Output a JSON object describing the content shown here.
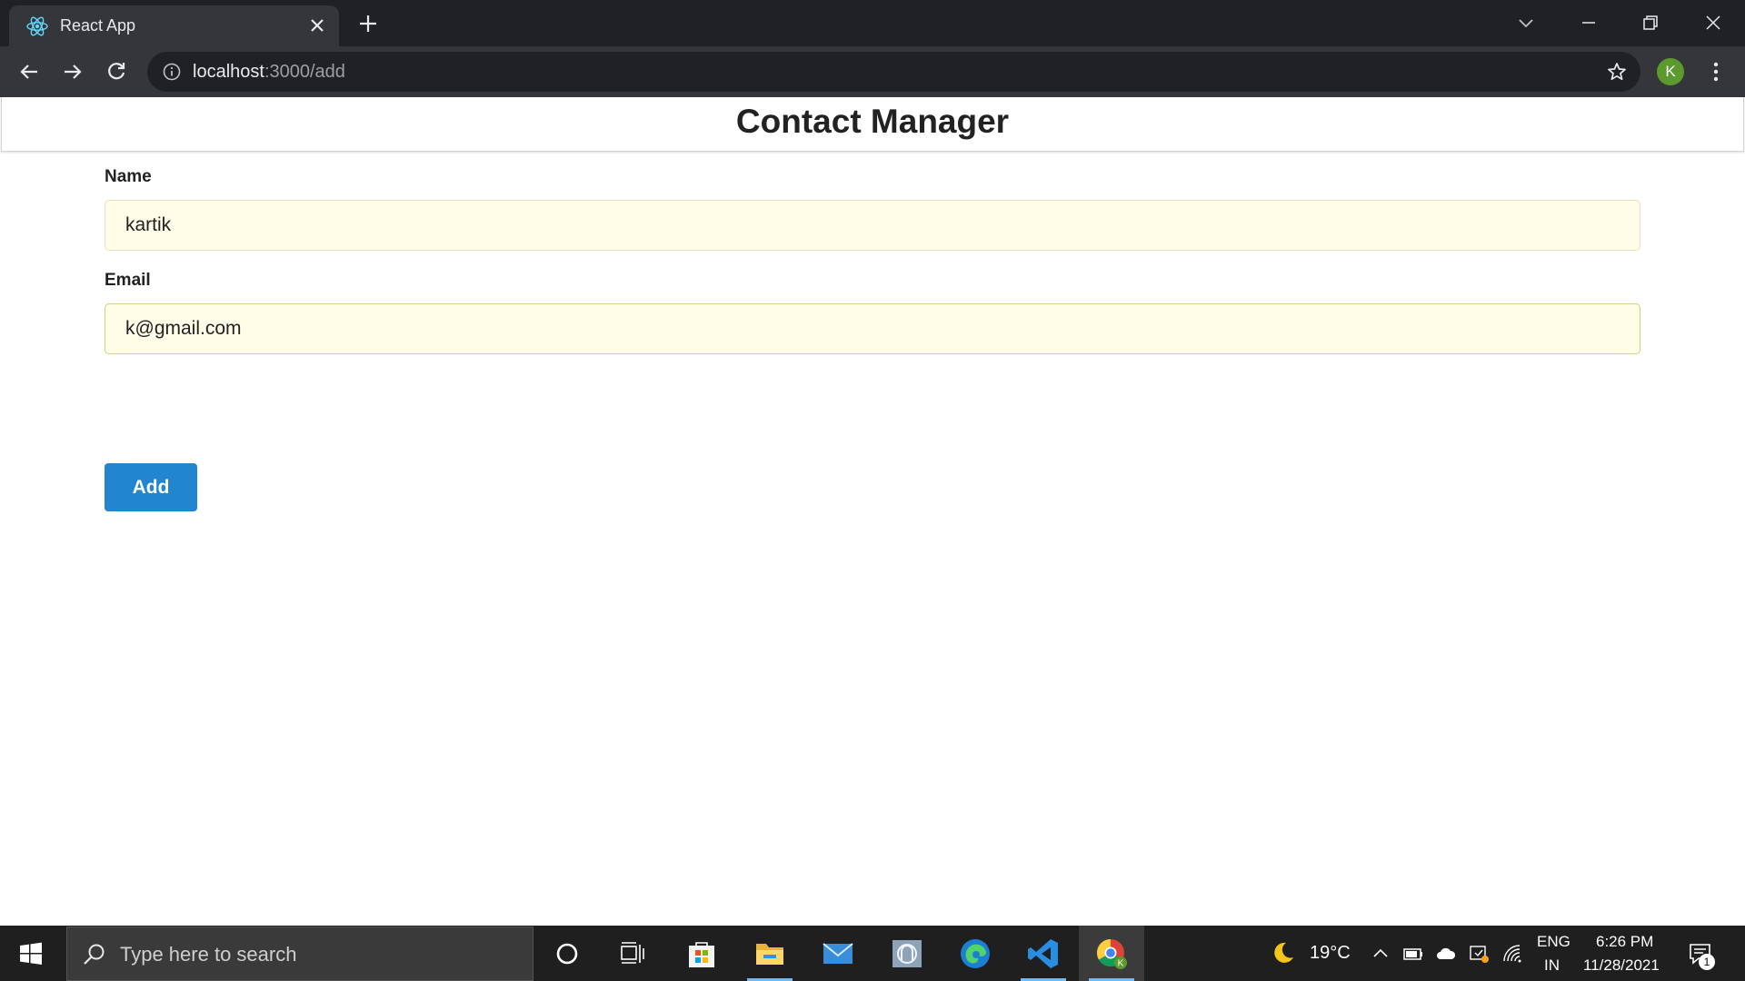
{
  "browser": {
    "tab_title": "React App",
    "url_host": "localhost",
    "url_path": ":3000/add",
    "profile_initial": "K"
  },
  "page": {
    "title": "Contact Manager",
    "form": {
      "name_label": "Name",
      "name_value": "kartik",
      "email_label": "Email",
      "email_value": "k@gmail.com",
      "add_label": "Add"
    }
  },
  "taskbar": {
    "search_placeholder": "Type here to search",
    "weather": "19°C",
    "language_top": "ENG",
    "language_bottom": "IN",
    "time": "6:26 PM",
    "date": "11/28/2021",
    "notification_count": "1"
  },
  "colors": {
    "primary_button": "#2185d0",
    "autofill_bg": "#fffde7",
    "browser_dark": "#202124",
    "browser_toolbar": "#35363a"
  }
}
